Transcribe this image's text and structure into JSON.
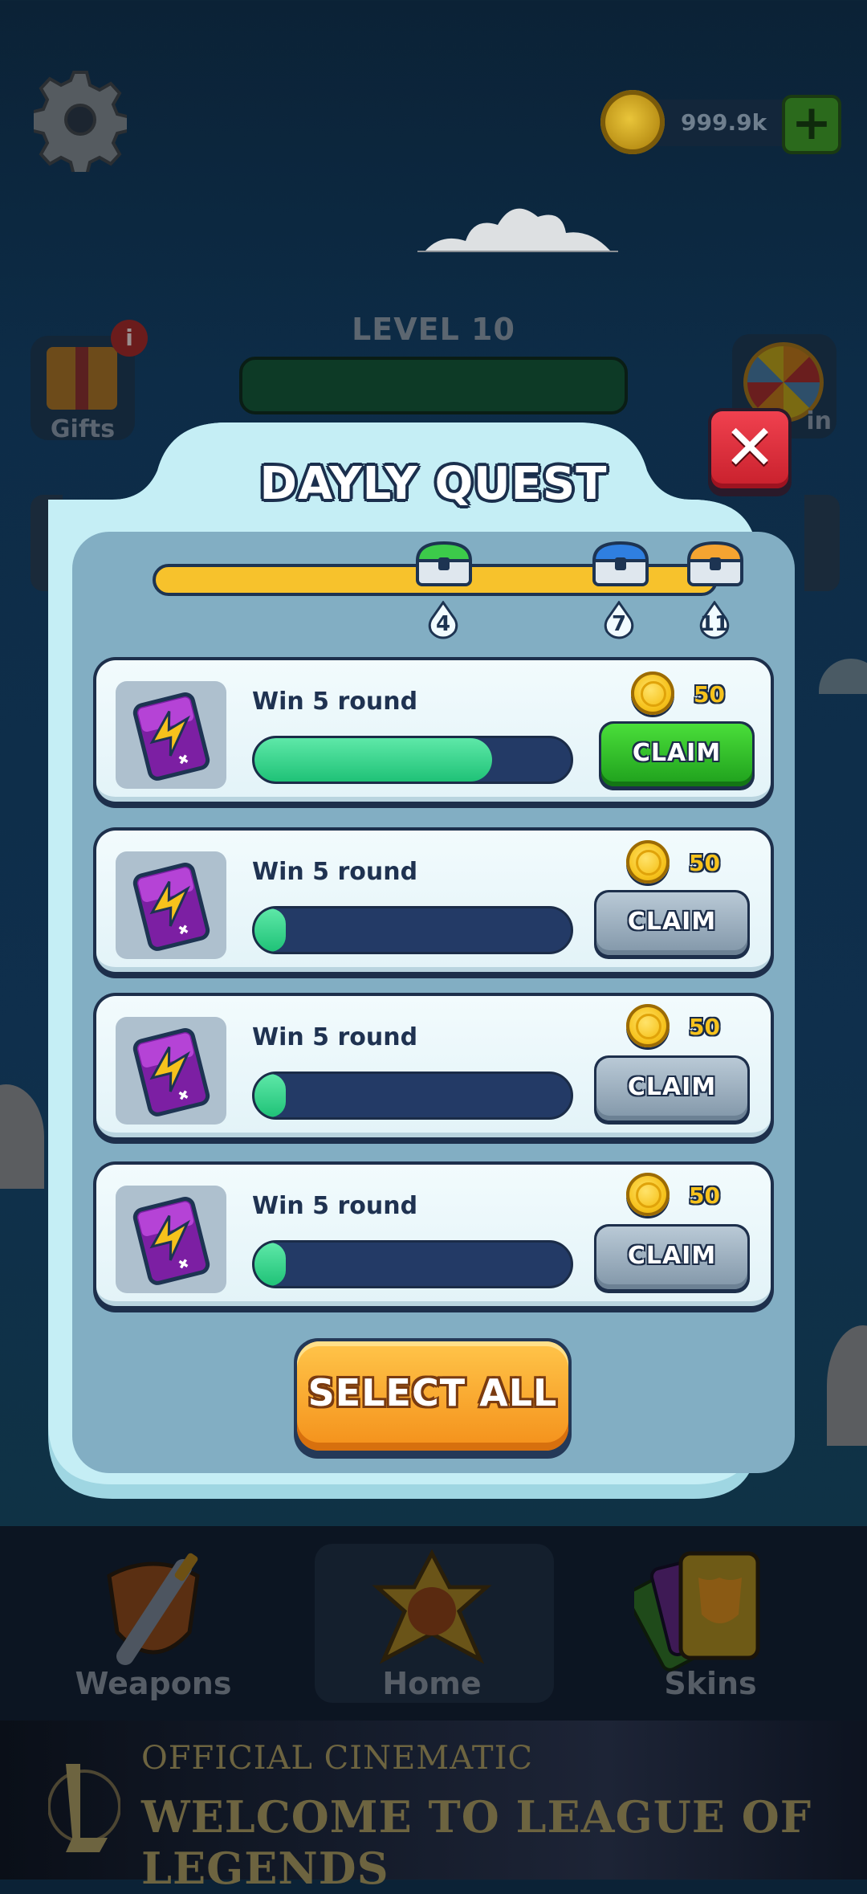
{
  "hud": {
    "coins": "999.9k",
    "plus_label": "+"
  },
  "level": {
    "label": "LEVEL 10"
  },
  "side_buttons": {
    "gifts_label": "Gifts",
    "gifts_badge": "i",
    "spin_label": "in"
  },
  "modal": {
    "title": "DAYLY QUEST",
    "close_label": "✕",
    "milestones": [
      "4",
      "7",
      "11"
    ],
    "quests": [
      {
        "title": "Win 5 round",
        "reward": "50",
        "progress": 0.75,
        "claim_label": "CLAIM",
        "claimable": true
      },
      {
        "title": "Win 5 round",
        "reward": "50",
        "progress": 0.08,
        "claim_label": "CLAIM",
        "claimable": false
      },
      {
        "title": "Win 5 round",
        "reward": "50",
        "progress": 0.08,
        "claim_label": "CLAIM",
        "claimable": false
      },
      {
        "title": "Win 5 round",
        "reward": "50",
        "progress": 0.08,
        "claim_label": "CLAIM",
        "claimable": false
      }
    ],
    "select_all_label": "SELECT ALL"
  },
  "nav": {
    "weapons": "Weapons",
    "home": "Home",
    "skins": "Skins"
  },
  "ad": {
    "line1": "OFFICIAL CINEMATIC",
    "line2": "WELCOME TO LEAGUE OF LEGENDS"
  },
  "colors": {
    "claim_active": "#2bbf27",
    "claim_inactive": "#9aaebd",
    "progress_fill": "#1fc277",
    "track_fill": "#f7c22c",
    "select_all": "#f7a52a"
  }
}
